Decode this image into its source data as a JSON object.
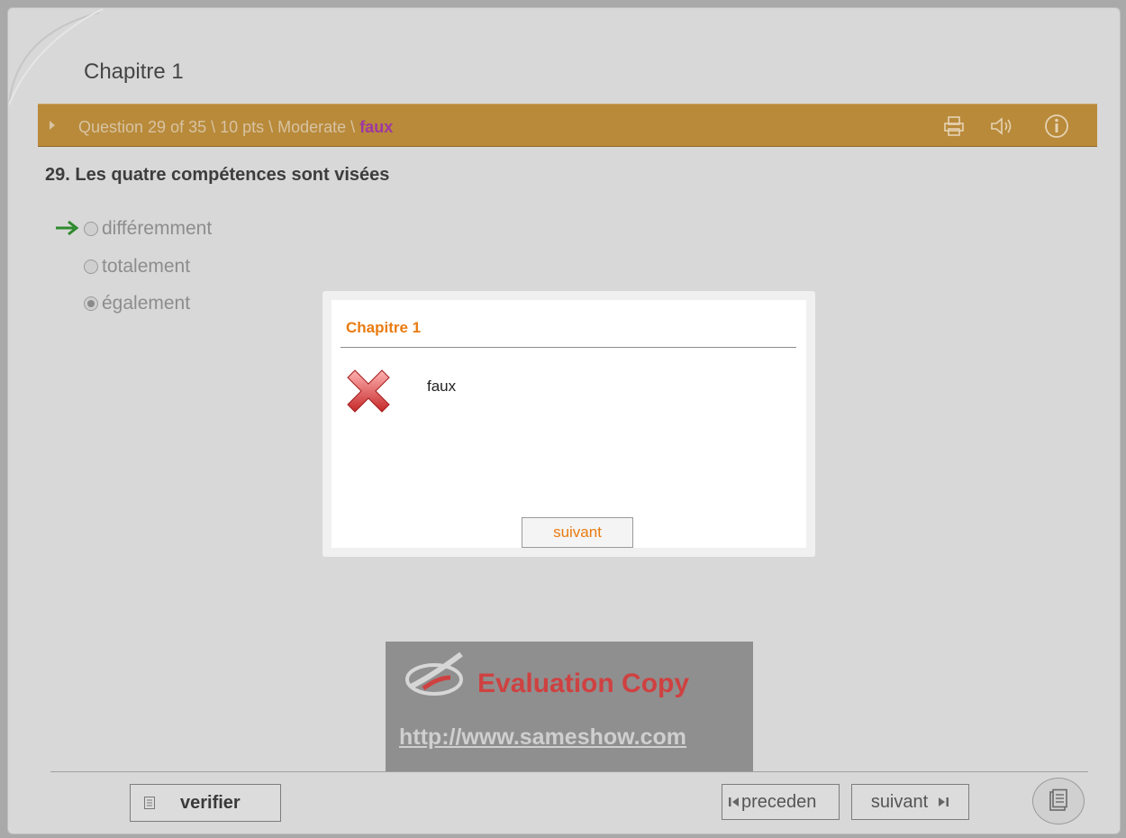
{
  "app": {
    "title": "Chapitre 1"
  },
  "question_bar": {
    "info_prefix": "Question 29 of 35 \\ 10 pts \\ Moderate \\ ",
    "status": "faux",
    "icons": [
      "printer-icon",
      "speaker-icon",
      "info-icon"
    ]
  },
  "question": {
    "text": "29.  Les quatre compétences sont visées",
    "options": [
      {
        "label": "différemment",
        "selected": false,
        "correct": true
      },
      {
        "label": "totalement",
        "selected": false,
        "correct": false
      },
      {
        "label": "également",
        "selected": true,
        "correct": false
      }
    ]
  },
  "dialog": {
    "title": "Chapitre 1",
    "message": "faux",
    "icon": "red-x-icon",
    "button_label": "suivant"
  },
  "watermark": {
    "title": "Evaluation Copy",
    "url": "http://www.sameshow.com"
  },
  "footer": {
    "verify_label": "verifier",
    "prev_label": "preceden",
    "next_label": "suivant",
    "menu_icon": "document-list-icon"
  },
  "colors": {
    "bar": "#b88a3a",
    "status": "#9f37a2",
    "accent": "#e97b11",
    "correct_arrow": "#2e8b2e",
    "watermark_title": "#cf4141"
  }
}
